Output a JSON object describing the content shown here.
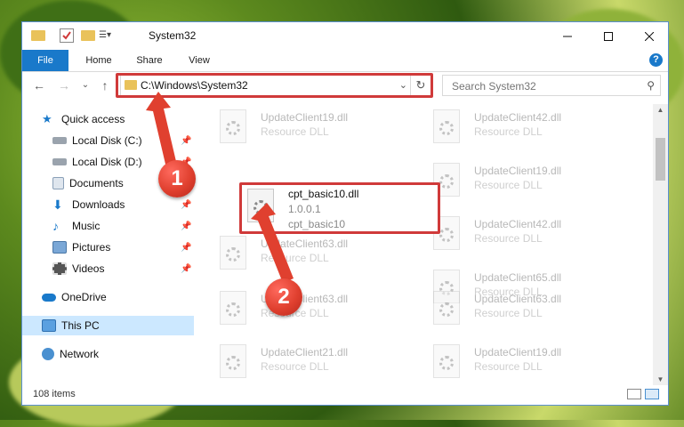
{
  "window": {
    "title": "System32"
  },
  "ribbon": {
    "tabs": [
      "File",
      "Home",
      "Share",
      "View"
    ],
    "help_label": "?"
  },
  "address": {
    "path": "C:\\Windows\\System32",
    "refresh_icon": "refresh-icon",
    "dropdown_icon": "chevron-down-icon"
  },
  "search": {
    "placeholder": "Search System32"
  },
  "sidebar": {
    "items": [
      {
        "label": "Quick access",
        "icon": "star-icon",
        "pinned": false
      },
      {
        "label": "Local Disk (C:)",
        "icon": "drive-icon",
        "pinned": true
      },
      {
        "label": "Local Disk (D:)",
        "icon": "drive-icon",
        "pinned": true
      },
      {
        "label": "Documents",
        "icon": "documents-icon",
        "pinned": true
      },
      {
        "label": "Downloads",
        "icon": "download-icon",
        "pinned": true
      },
      {
        "label": "Music",
        "icon": "music-icon",
        "pinned": true
      },
      {
        "label": "Pictures",
        "icon": "pictures-icon",
        "pinned": true
      },
      {
        "label": "Videos",
        "icon": "videos-icon",
        "pinned": true
      },
      {
        "label": "OneDrive",
        "icon": "cloud-icon",
        "pinned": false
      },
      {
        "label": "This PC",
        "icon": "pc-icon",
        "pinned": false
      },
      {
        "label": "Network",
        "icon": "network-icon",
        "pinned": false
      }
    ]
  },
  "files": {
    "left": [
      {
        "name": "UpdateClient19.dll",
        "type": "Resource DLL"
      },
      {
        "name": "UpdateClient63.dll",
        "type": "Resource DLL"
      },
      {
        "name": "UpdateClient63.dll",
        "type": "Resource DLL"
      },
      {
        "name": "UpdateClient21.dll",
        "type": "Resource DLL"
      }
    ],
    "right": [
      {
        "name": "UpdateClient42.dll",
        "type": "Resource DLL"
      },
      {
        "name": "UpdateClient19.dll",
        "type": "Resource DLL"
      },
      {
        "name": "UpdateClient42.dll",
        "type": "Resource DLL"
      },
      {
        "name": "UpdateClient65.dll",
        "type": "Resource DLL"
      },
      {
        "name": "UpdateClient63.dll",
        "type": "Resource DLL"
      },
      {
        "name": "UpdateClient19.dll",
        "type": "Resource DLL"
      }
    ],
    "featured": {
      "name": "cpt_basic10.dll",
      "version": "1.0.0.1",
      "description": "cpt_basic10"
    }
  },
  "status": {
    "item_count": "108 items"
  },
  "annotations": {
    "step1": "1",
    "step2": "2"
  },
  "colors": {
    "accent": "#1979ca",
    "highlight": "#d03a3a",
    "selected": "#cce8ff"
  }
}
